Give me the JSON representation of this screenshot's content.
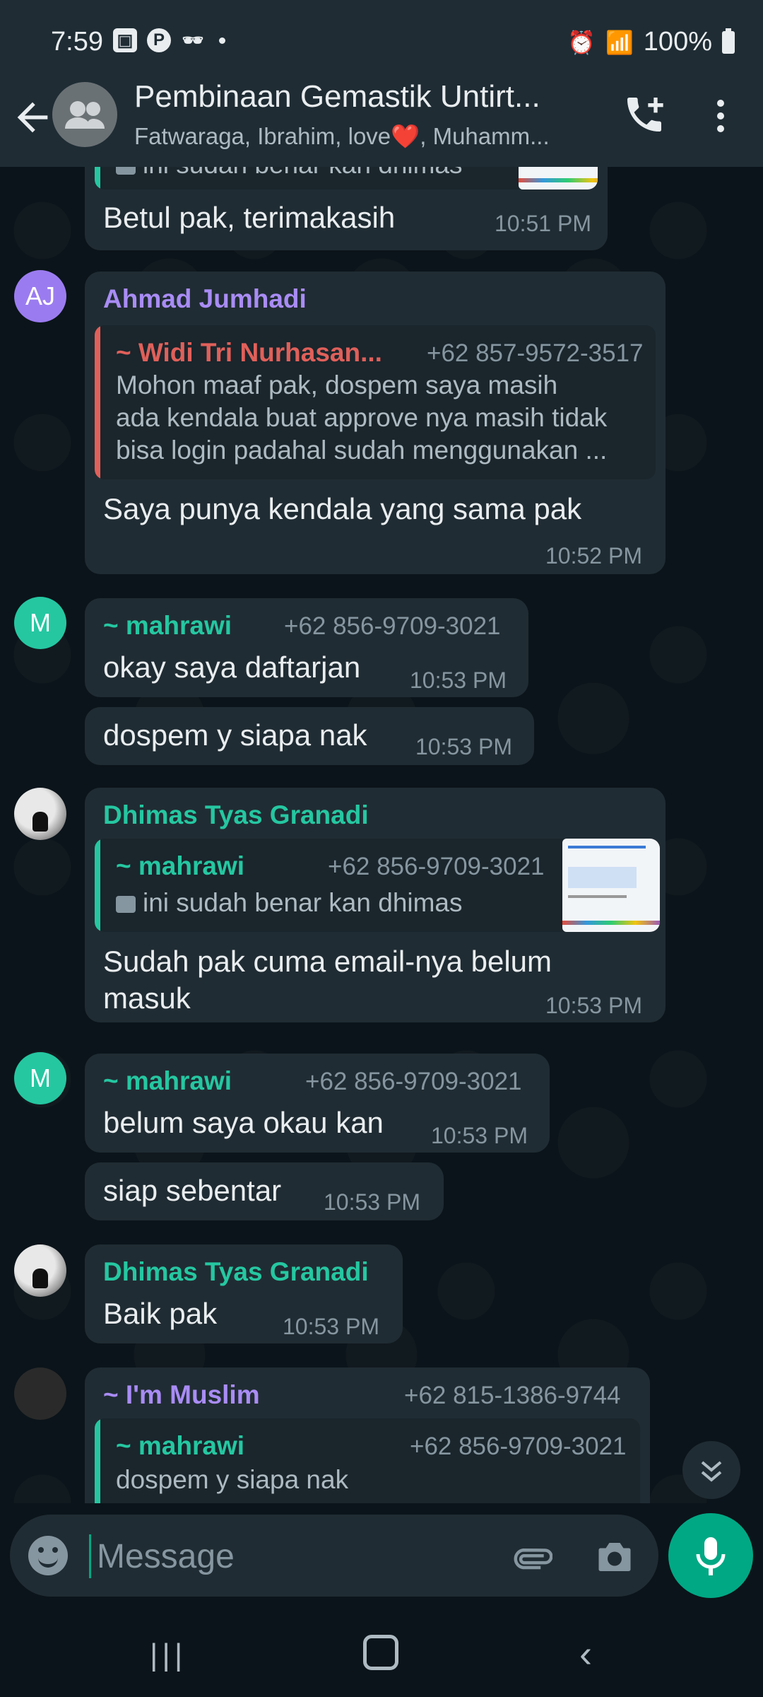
{
  "status_bar": {
    "time": "7:59",
    "battery": "100%",
    "icons": [
      "gallery-icon",
      "pinterest-icon",
      "incognito-icon",
      "alarm-icon",
      "wifi-icon",
      "signal-icon",
      "battery-icon"
    ]
  },
  "header": {
    "title": "Pembinaan Gemastik Untirt...",
    "subtitle": "Fatwaraga, Ibrahim, love❤️, Muhamm..."
  },
  "messages": {
    "m0": {
      "quote_text": "ini sudah benar kan dhimas",
      "text": "Betul pak, terimakasih",
      "time": "10:51 PM"
    },
    "m1": {
      "avatar": "AJ",
      "sender": "Ahmad Jumhadi",
      "quote_name": "~ Widi Tri Nurhasan...",
      "quote_phone": "+62 857-9572-3517",
      "quote_line1": "Mohon maaf pak, dospem saya masih",
      "quote_line2": "ada kendala buat approve nya masih tidak",
      "quote_line3": "bisa login padahal sudah menggunakan ...",
      "text": "Saya punya kendala yang sama pak",
      "time": "10:52 PM"
    },
    "m2": {
      "avatar": "M",
      "sender": "~ mahrawi",
      "phone": "+62 856-9709-3021",
      "text": "okay saya daftarjan",
      "time": "10:53 PM"
    },
    "m3": {
      "text": "dospem y siapa nak",
      "time": "10:53 PM"
    },
    "m4": {
      "sender": "Dhimas Tyas Granadi",
      "quote_name": "~ mahrawi",
      "quote_phone": "+62 856-9709-3021",
      "quote_text": "ini sudah benar kan dhimas",
      "text_line1": "Sudah pak cuma email-nya belum",
      "text_line2": "masuk",
      "time": "10:53 PM"
    },
    "m5": {
      "avatar": "M",
      "sender": "~ mahrawi",
      "phone": "+62 856-9709-3021",
      "text": "belum saya okau kan",
      "time": "10:53 PM"
    },
    "m6": {
      "text": "siap sebentar",
      "time": "10:53 PM"
    },
    "m7": {
      "sender": "Dhimas Tyas Granadi",
      "text": "Baik pak",
      "time": "10:53 PM"
    },
    "m8": {
      "sender": "~ I'm Muslim",
      "phone": "+62 815-1386-9744",
      "quote_name": "~ mahrawi",
      "quote_phone": "+62 856-9709-3021",
      "quote_text": "dospem y siapa nak"
    }
  },
  "composer": {
    "placeholder": "Message"
  },
  "colors": {
    "purple_sender": "#a98cf5",
    "green_sender": "#25c7a1",
    "red_sender": "#e0605a",
    "accent": "#00a884"
  }
}
